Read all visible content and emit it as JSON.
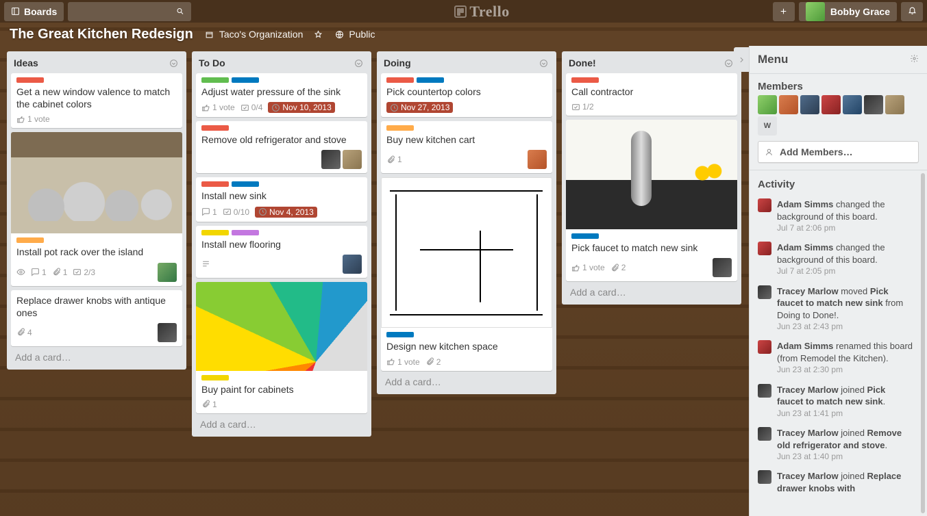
{
  "header": {
    "boards_btn": "Boards",
    "search_placeholder": "",
    "logo_text": "Trello",
    "user_name": "Bobby Grace"
  },
  "board": {
    "title": "The Great Kitchen Redesign",
    "org_label": "Taco's Organization",
    "visibility": "Public"
  },
  "lists": [
    {
      "name": "Ideas",
      "add_card": "Add a card…",
      "cards": [
        {
          "labels": [
            "red"
          ],
          "title": "Get a new window valence to match the cabinet colors",
          "votes": "1 vote"
        },
        {
          "cover": "pots",
          "labels": [
            "orange"
          ],
          "title": "Install pot rack over the island",
          "badges": {
            "eye": true,
            "comments": "1",
            "attach": "1",
            "check": "2/3"
          },
          "members": [
            "p5"
          ]
        },
        {
          "title": "Replace drawer knobs with antique ones",
          "badges": {
            "attach": "4"
          },
          "members": [
            "p7"
          ]
        }
      ]
    },
    {
      "name": "To Do",
      "add_card": "Add a card…",
      "cards": [
        {
          "labels": [
            "green",
            "blue"
          ],
          "title": "Adjust water pressure of the sink",
          "badges": {
            "votes": "1 vote",
            "check": "0/4",
            "due": "Nov 10, 2013",
            "due_soon": true
          }
        },
        {
          "labels": [
            "red"
          ],
          "title": "Remove old refrigerator and stove",
          "members": [
            "p7",
            "p8"
          ]
        },
        {
          "labels": [
            "red",
            "blue"
          ],
          "title": "Install new sink",
          "badges": {
            "comments": "1",
            "check": "0/10",
            "due": "Nov 4, 2013",
            "due_soon": true
          }
        },
        {
          "labels": [
            "yellow",
            "purple"
          ],
          "title": "Install new flooring",
          "badges": {
            "desc": true
          },
          "members": [
            "p3"
          ]
        },
        {
          "cover": "paint",
          "labels": [
            "yellow"
          ],
          "title": "Buy paint for cabinets",
          "badges": {
            "attach": "1"
          }
        }
      ]
    },
    {
      "name": "Doing",
      "add_card": "Add a card…",
      "cards": [
        {
          "labels": [
            "red",
            "blue"
          ],
          "title": "Pick countertop colors",
          "badges": {
            "due": "Nov 27, 2013",
            "due_soon": true
          }
        },
        {
          "labels": [
            "orange"
          ],
          "title": "Buy new kitchen cart",
          "badges": {
            "attach": "1"
          },
          "members": [
            "p2"
          ]
        },
        {
          "cover": "plan",
          "labels": [
            "blue"
          ],
          "title": "Design new kitchen space",
          "badges": {
            "votes": "1 vote",
            "attach": "2"
          }
        }
      ]
    },
    {
      "name": "Done!",
      "add_card": "Add a card…",
      "cards": [
        {
          "labels": [
            "red"
          ],
          "title": "Call contractor",
          "badges": {
            "check": "1/2"
          }
        },
        {
          "cover": "faucet",
          "labels": [
            "blue"
          ],
          "title": "Pick faucet to match new sink",
          "badges": {
            "votes": "1 vote",
            "attach": "2"
          },
          "members": [
            "p7"
          ]
        }
      ]
    }
  ],
  "sidebar": {
    "menu_title": "Menu",
    "members_title": "Members",
    "add_members": "Add Members…",
    "member_initial": "W",
    "activity_title": "Activity",
    "activity": [
      {
        "who": "Adam Simms",
        "text_a": " changed the background of this board.",
        "time": "Jul 7 at 2:06 pm",
        "av": "p4"
      },
      {
        "who": "Adam Simms",
        "text_a": " changed the background of this board.",
        "time": "Jul 7 at 2:05 pm",
        "av": "p4"
      },
      {
        "who": "Tracey Marlow",
        "text_a": " moved ",
        "obj": "Pick faucet to match new sink",
        "text_b": " from Doing to Done!.",
        "time": "Jun 23 at 2:43 pm",
        "av": "p7"
      },
      {
        "who": "Adam Simms",
        "text_a": " renamed this board (from Remodel the Kitchen). ",
        "time": "Jun 23 at 2:30 pm",
        "av": "p4"
      },
      {
        "who": "Tracey Marlow",
        "text_a": " joined ",
        "obj": "Pick faucet to match new sink",
        "text_b": ".",
        "time": "Jun 23 at 1:41 pm",
        "av": "p7"
      },
      {
        "who": "Tracey Marlow",
        "text_a": " joined ",
        "obj": "Remove old refrigerator and stove",
        "text_b": ". ",
        "time": "Jun 23 at 1:40 pm",
        "av": "p7"
      },
      {
        "who": "Tracey Marlow",
        "text_a": " joined ",
        "obj": "Replace drawer knobs with",
        "av": "p7"
      }
    ]
  }
}
